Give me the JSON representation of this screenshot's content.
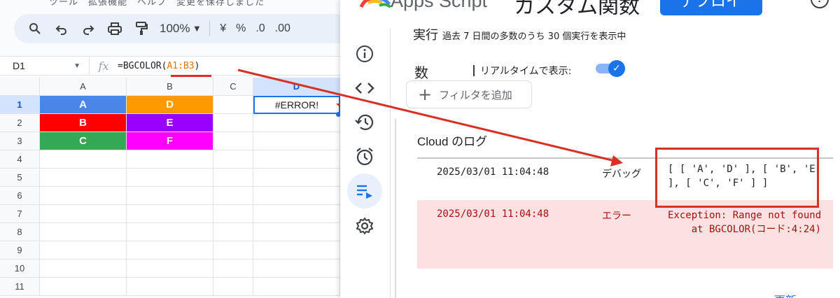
{
  "sheets": {
    "menu_ghost": "ツール　拡張機能　ヘルプ　変更を保存しました",
    "toolbar": {
      "zoom": "100%",
      "currency": "¥",
      "percent": "%",
      "decrease_decimal": ".0",
      "increase_decimal": ".00"
    },
    "name_box": "D1",
    "formula_prefix": "=BGCOLOR(",
    "formula_ref": "A1:B3",
    "formula_suffix": ")",
    "columns": [
      "A",
      "B",
      "C",
      "D"
    ],
    "rows": [
      "1",
      "2",
      "3",
      "4",
      "5",
      "6",
      "7",
      "8",
      "9",
      "10",
      "11"
    ],
    "cells": {
      "A1": "A",
      "B1": "D",
      "A2": "B",
      "B2": "E",
      "A3": "C",
      "B3": "F",
      "D1": "#ERROR!"
    },
    "cell_colors": {
      "A1": "#4a86e8",
      "B1": "#ff9900",
      "A2": "#ff0000",
      "B2": "#9900ff",
      "A3": "#34a853",
      "B3": "#ff00ff"
    }
  },
  "apps_script": {
    "app_title": "Apps Script",
    "project_title": "カスタム関数",
    "deploy_label": "デプロイ",
    "exec_label": "実行",
    "exec_note": "過去 7 日間の多数のうち 30 個実行を表示中",
    "count_label": "数",
    "realtime_label": "リアルタイムで表示:",
    "realtime_enabled": true,
    "filter_label": "フィルタを追加",
    "logs_title": "Cloud のログ",
    "logs": [
      {
        "timestamp": "2025/03/01 11:04:48",
        "level": "デバッグ",
        "message": "[ [ 'A', 'D' ], [ 'B', 'E' ], [ 'C', 'F' ] ]"
      },
      {
        "timestamp": "2025/03/01 11:04:48",
        "level": "エラー",
        "message": "Exception: Range not found\n    at BGCOLOR(コード:4:24)"
      }
    ],
    "update_peek": "更新"
  },
  "colors": {
    "accent": "#1a73e8",
    "annotation_red": "#d93025",
    "error_row_bg": "#fbe1e1",
    "error_text": "#a50e0e"
  },
  "icons": {
    "rail": [
      "info-icon",
      "code-icon",
      "history-icon",
      "alarm-icon",
      "executions-icon",
      "settings-icon"
    ]
  }
}
